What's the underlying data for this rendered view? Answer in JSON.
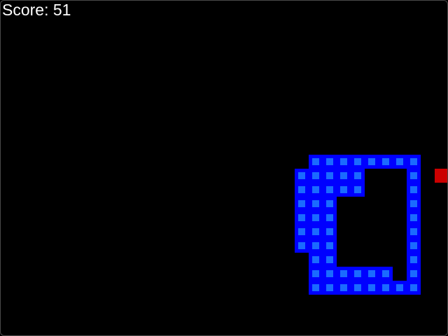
{
  "score": {
    "text": "Score: 51"
  },
  "board": {
    "cols": 32,
    "rows": 24,
    "snake_cells": [
      [
        22,
        11
      ],
      [
        23,
        11
      ],
      [
        24,
        11
      ],
      [
        25,
        11
      ],
      [
        26,
        11
      ],
      [
        27,
        11
      ],
      [
        28,
        11
      ],
      [
        29,
        11
      ],
      [
        21,
        12
      ],
      [
        22,
        12
      ],
      [
        23,
        12
      ],
      [
        24,
        12
      ],
      [
        25,
        12
      ],
      [
        29,
        12
      ],
      [
        21,
        13
      ],
      [
        22,
        13
      ],
      [
        23,
        13
      ],
      [
        24,
        13
      ],
      [
        25,
        13
      ],
      [
        29,
        13
      ],
      [
        21,
        14
      ],
      [
        22,
        14
      ],
      [
        23,
        14
      ],
      [
        29,
        14
      ],
      [
        21,
        15
      ],
      [
        22,
        15
      ],
      [
        23,
        15
      ],
      [
        29,
        15
      ],
      [
        21,
        16
      ],
      [
        22,
        16
      ],
      [
        23,
        16
      ],
      [
        29,
        16
      ],
      [
        21,
        17
      ],
      [
        22,
        17
      ],
      [
        23,
        17
      ],
      [
        29,
        17
      ],
      [
        22,
        18
      ],
      [
        23,
        18
      ],
      [
        29,
        18
      ],
      [
        22,
        19
      ],
      [
        23,
        19
      ],
      [
        24,
        19
      ],
      [
        25,
        19
      ],
      [
        26,
        19
      ],
      [
        27,
        19
      ],
      [
        29,
        19
      ],
      [
        22,
        20
      ],
      [
        23,
        20
      ],
      [
        24,
        20
      ],
      [
        25,
        20
      ],
      [
        26,
        20
      ],
      [
        27,
        20
      ],
      [
        28,
        20
      ],
      [
        29,
        20
      ]
    ],
    "food_cell": [
      31,
      12
    ]
  },
  "colors": {
    "background": "#000000",
    "snake_outer": "#0000ff",
    "snake_inner": "#1a6bff",
    "food": "#cc0000",
    "score_text": "#ffffff"
  }
}
